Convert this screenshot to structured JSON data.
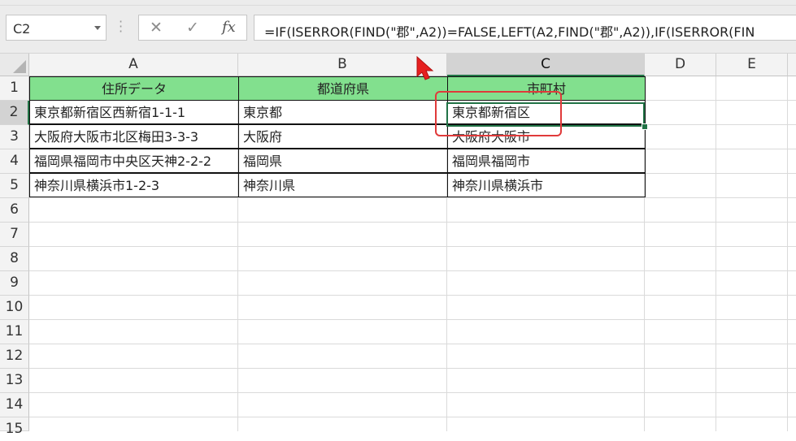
{
  "name_box": {
    "value": "C2"
  },
  "formula_bar": {
    "cancel_icon": "✕",
    "enter_icon": "✓",
    "function_icon": "fx",
    "formula": "=IF(ISERROR(FIND(\"郡\",A2))=FALSE,LEFT(A2,FIND(\"郡\",A2)),IF(ISERROR(FIN"
  },
  "columns": [
    "A",
    "B",
    "C",
    "D",
    "E"
  ],
  "rows": [
    "1",
    "2",
    "3",
    "4",
    "5",
    "6",
    "7",
    "8",
    "9",
    "10",
    "11",
    "12",
    "13",
    "14",
    "15"
  ],
  "table": {
    "headers": [
      "住所データ",
      "都道府県",
      "市町村"
    ],
    "rows": [
      [
        "東京都新宿区西新宿1-1-1",
        "東京都",
        "東京都新宿区"
      ],
      [
        "大阪府大阪市北区梅田3-3-3",
        "大阪府",
        "大阪府大阪市"
      ],
      [
        "福岡県福岡市中央区天神2-2-2",
        "福岡県",
        "福岡県福岡市"
      ],
      [
        "神奈川県横浜市1-2-3",
        "神奈川県",
        "神奈川県横浜市"
      ]
    ]
  },
  "selection": {
    "cell": "C2",
    "column": "C",
    "row": "2"
  },
  "colors": {
    "header_fill": "#82e08e",
    "selection": "#217346",
    "annotation": "#e03a3a"
  }
}
